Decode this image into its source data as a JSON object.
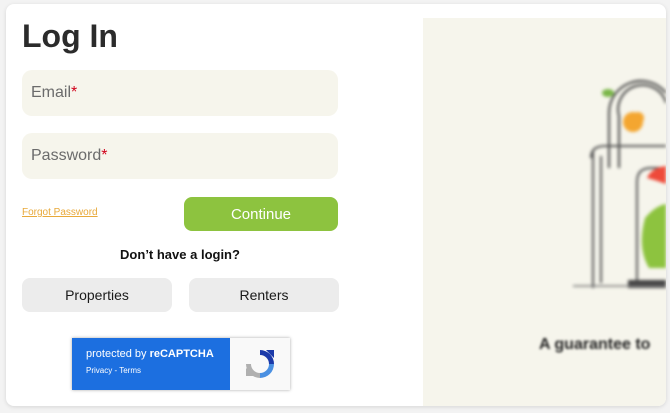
{
  "login": {
    "title": "Log In",
    "email_label": "Email",
    "password_label": "Password",
    "required_mark": "*",
    "forgot_password": "Forgot Password",
    "continue_label": "Continue",
    "no_login_text": "Don’t have a login?",
    "properties_label": "Properties",
    "renters_label": "Renters"
  },
  "recaptcha": {
    "protected_prefix": "protected by ",
    "brand": "reCAPTCHA",
    "privacy": "Privacy",
    "separator": " - ",
    "terms": "Terms"
  },
  "hero": {
    "tagline": "A guarantee to",
    "illustration_icon": "padlock-illustration"
  },
  "colors": {
    "accent_green": "#8dc33f",
    "link_orange": "#e8a93a",
    "required_red": "#d0021b",
    "recaptcha_blue": "#1c6fe0",
    "field_bg": "#f6f5ec"
  }
}
